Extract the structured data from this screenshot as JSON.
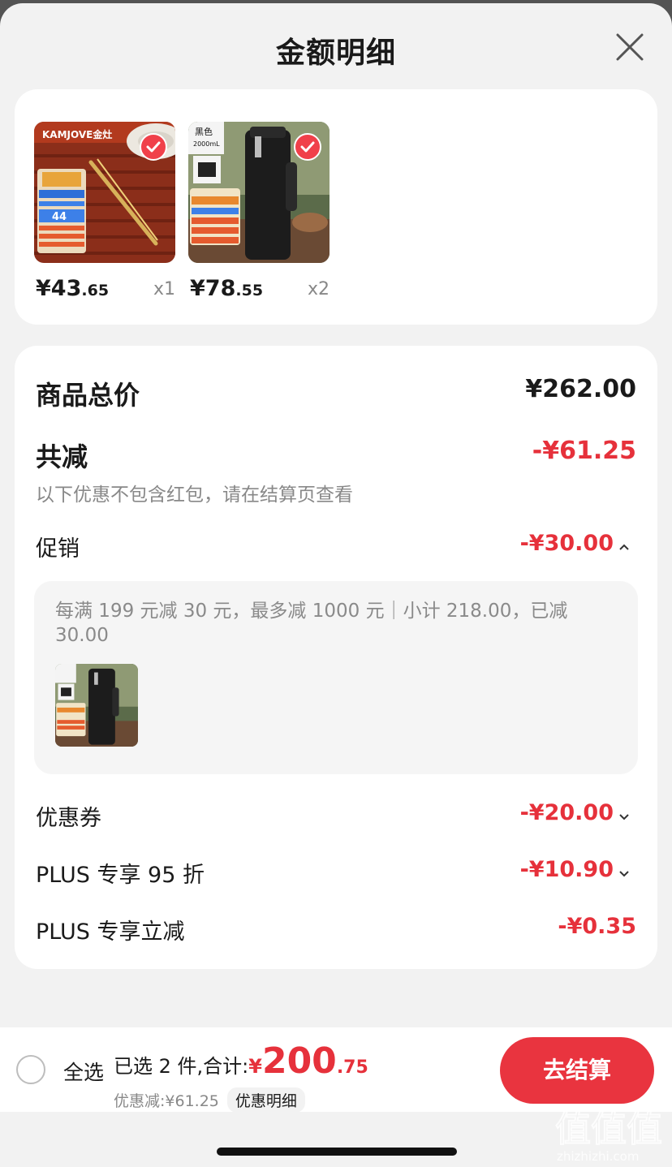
{
  "title": "金额明细",
  "products": [
    {
      "price_int": "¥43",
      "price_dec": ".65",
      "qty": "x1",
      "brand": "KAMJOVE金灶",
      "badge": "44",
      "selected": true
    },
    {
      "price_int": "¥78",
      "price_dec": ".55",
      "qty": "x2",
      "tag": "黑色",
      "tag2": "2000mL",
      "selected": true
    }
  ],
  "summary": {
    "total_label": "商品总价",
    "total_value": "¥262.00",
    "discount_label": "共减",
    "discount_value": "-¥61.25",
    "discount_hint": "以下优惠不包含红包，请在结算页查看",
    "promo_label": "促销",
    "promo_value": "-¥30.00",
    "promo_detail": "每满 199 元减 30 元，最多减 1000 元｜小计 218.00，已减 30.00",
    "coupon_label": "优惠券",
    "coupon_value": "-¥20.00",
    "plus95_label": "PLUS 专享 95 折",
    "plus95_value": "-¥10.90",
    "plusCut_label": "PLUS 专享立减",
    "plusCut_value": "-¥0.35"
  },
  "bottom": {
    "select_all": "全选",
    "selected_prefix": "已选 2 件,合计:",
    "yen": "¥",
    "total_int": "200",
    "total_dec": ".75",
    "saving": "优惠减:¥61.25",
    "detail_link": "优惠明细",
    "checkout": "去结算"
  },
  "watermark": {
    "line1": "值值值",
    "line2": "zhizhizhi.com"
  },
  "colors": {
    "accent": "#e6313b",
    "button": "#e9343f",
    "sheet": "#f2f2f2"
  }
}
